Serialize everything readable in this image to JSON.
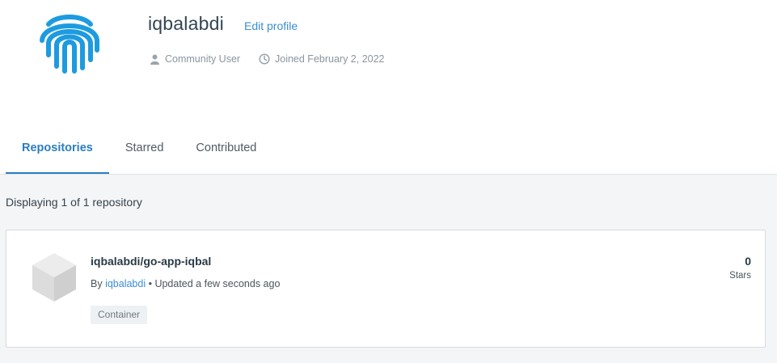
{
  "profile": {
    "username": "iqbalabdi",
    "edit_label": "Edit profile",
    "user_type": "Community User",
    "joined": "Joined February 2, 2022",
    "avatar_icon": "fingerprint-icon",
    "brand_color": "#1d9be0"
  },
  "tabs": [
    {
      "label": "Repositories",
      "active": true
    },
    {
      "label": "Starred",
      "active": false
    },
    {
      "label": "Contributed",
      "active": false
    }
  ],
  "results": {
    "displaying": "Displaying 1 of 1 repository"
  },
  "repositories": [
    {
      "name": "iqbalabdi/go-app-iqbal",
      "by_label": "By",
      "owner": "iqbalabdi",
      "updated": " • Updated a few seconds ago",
      "tag": "Container",
      "stars": "0",
      "stars_label": "Stars",
      "icon": "cube-icon"
    }
  ],
  "colors": {
    "accent": "#2b7dc0",
    "link": "#3a8ed4",
    "content_background": "#f4f5f7"
  }
}
